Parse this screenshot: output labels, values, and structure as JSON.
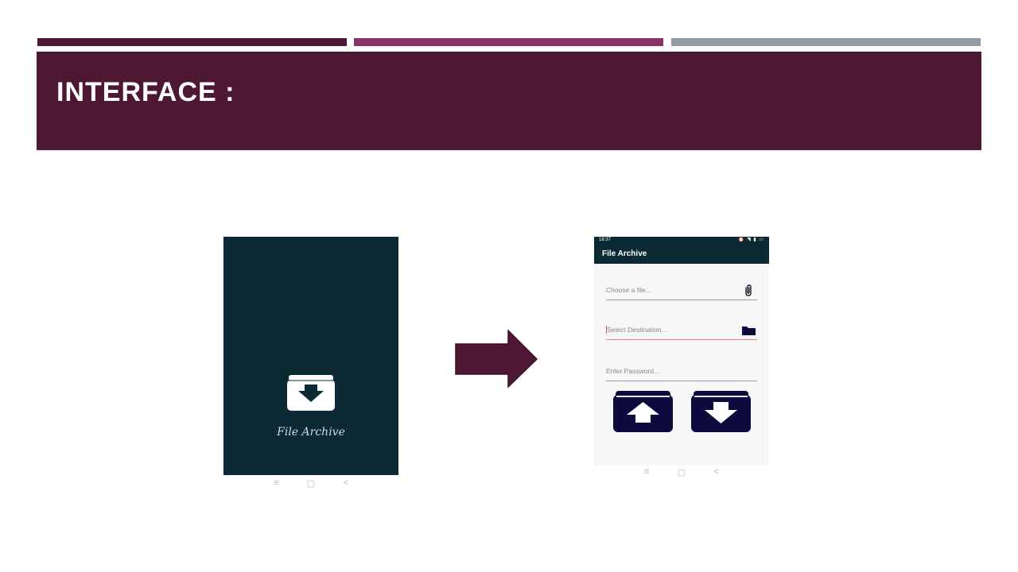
{
  "slide": {
    "title": "INTERFACE :"
  },
  "splash_screen": {
    "app_name": "File Archive",
    "background_color": "#0b2a33",
    "icon": "archive-download-icon",
    "nav_buttons": [
      "≡",
      "▢",
      "<"
    ]
  },
  "transition_arrow": {
    "icon": "right-arrow-icon",
    "color": "#4e1733"
  },
  "app_screen": {
    "status_bar": {
      "time": "18:37",
      "icons": "⏰ ◥ ▮ ▭"
    },
    "title": "File Archive",
    "fields": {
      "file": {
        "placeholder": "Choose a file...",
        "icon": "paperclip-icon"
      },
      "destination": {
        "placeholder": "Select Destination...",
        "icon": "folder-icon",
        "focused": true
      },
      "password": {
        "placeholder": "Enter Password..."
      }
    },
    "buttons": {
      "upload": {
        "icon": "archive-upload-icon"
      },
      "download": {
        "icon": "archive-download-icon"
      }
    },
    "nav_buttons": [
      "≡",
      "▢",
      "<"
    ]
  },
  "colors": {
    "accent_dark": "#4e1733",
    "accent_mid": "#8a3263",
    "accent_grey": "#939aa1",
    "button_navy": "#0d0b3d",
    "focus_underline": "#e07a97"
  }
}
